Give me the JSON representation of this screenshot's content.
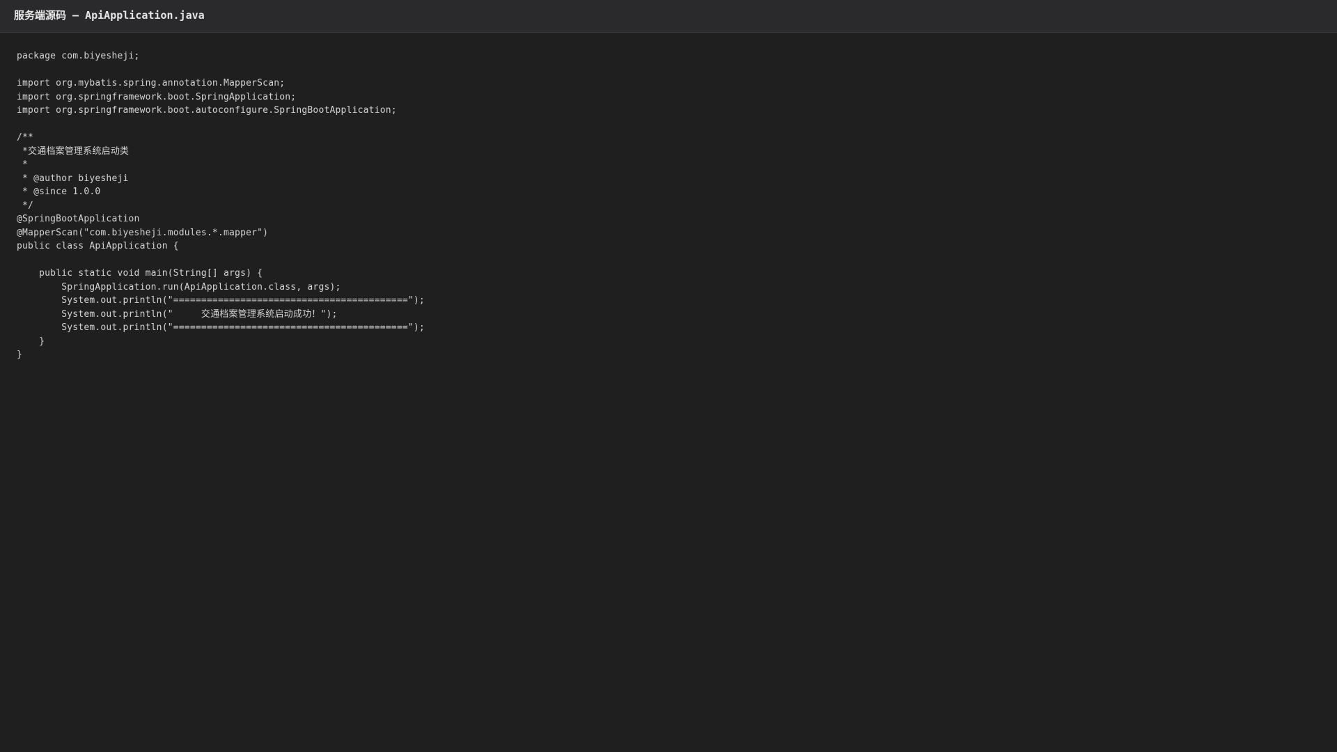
{
  "window": {
    "title": "服务端源码 — ApiApplication.java"
  },
  "editor": {
    "lines": [
      "package com.biyesheji;",
      "",
      "import org.mybatis.spring.annotation.MapperScan;",
      "import org.springframework.boot.SpringApplication;",
      "import org.springframework.boot.autoconfigure.SpringBootApplication;",
      "",
      "/**",
      " *交通档案管理系统启动类",
      " *",
      " * @author biyesheji",
      " * @since 1.0.0",
      " */",
      "@SpringBootApplication",
      "@MapperScan(\"com.biyesheji.modules.*.mapper\")",
      "public class ApiApplication {",
      "",
      "    public static void main(String[] args) {",
      "        SpringApplication.run(ApiApplication.class, args);",
      "        System.out.println(\"==========================================\");",
      "        System.out.println(\"     交通档案管理系统启动成功！\");",
      "        System.out.println(\"==========================================\");",
      "    }",
      "}"
    ]
  }
}
